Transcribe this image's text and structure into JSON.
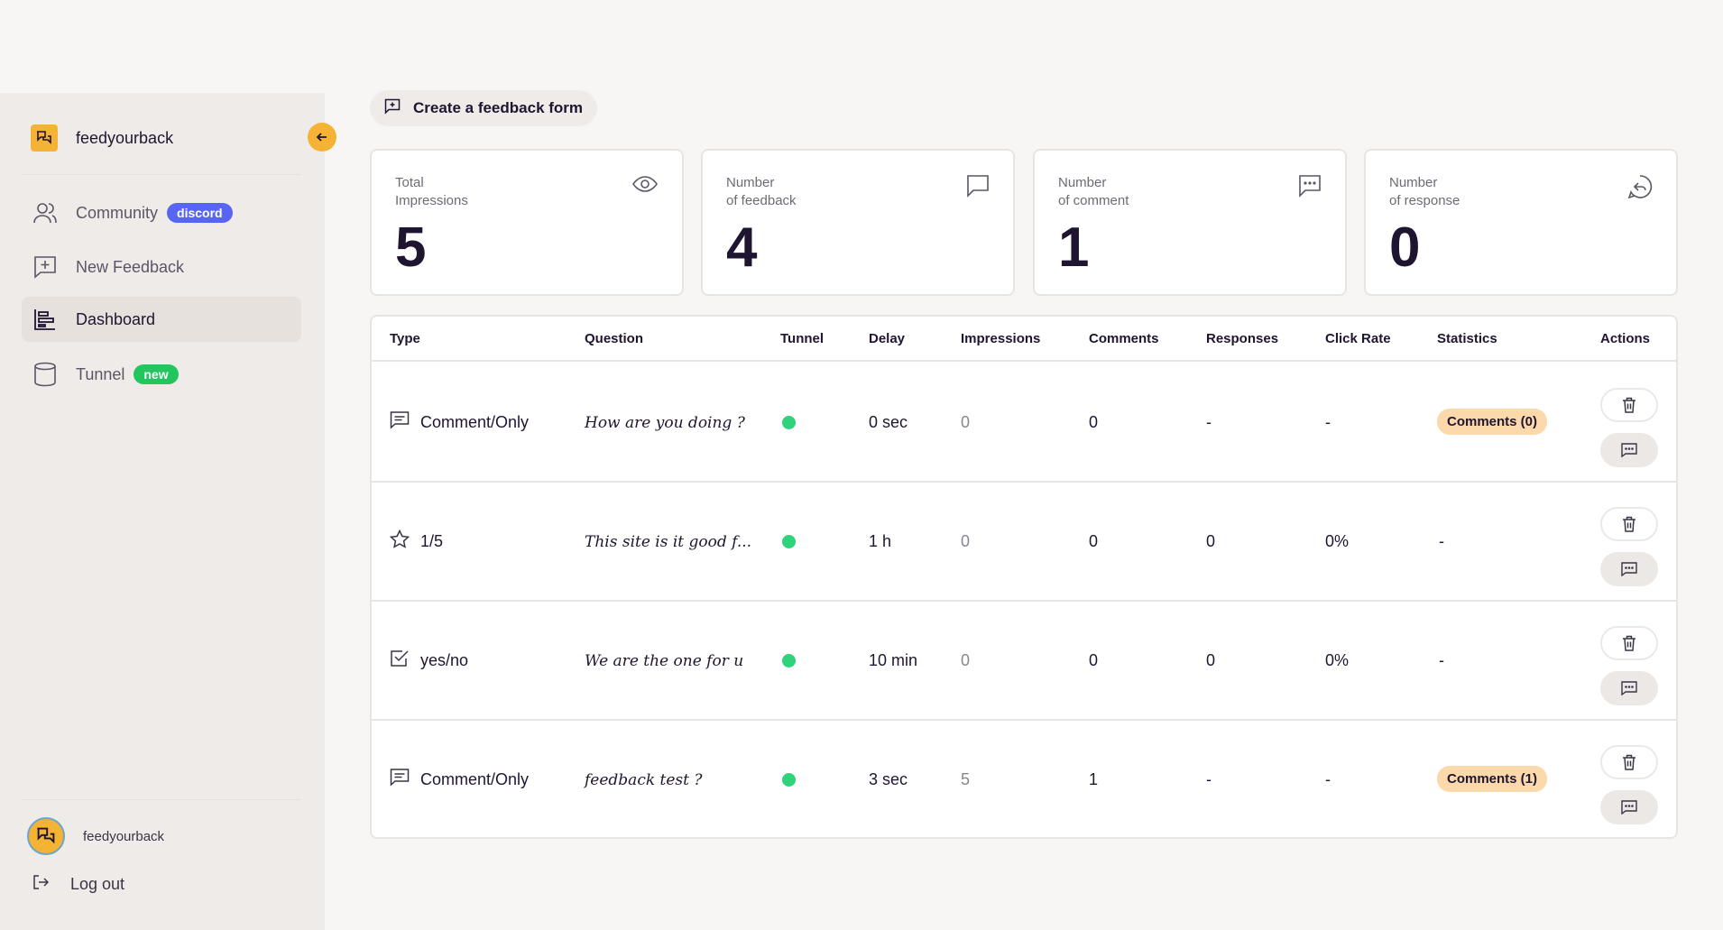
{
  "sidebar": {
    "brand_name": "feedyourback",
    "items": [
      {
        "label": "Community",
        "badge": "discord"
      },
      {
        "label": "New Feedback"
      },
      {
        "label": "Dashboard",
        "active": true
      },
      {
        "label": "Tunnel",
        "badge": "new"
      }
    ],
    "user_name": "feedyourback",
    "logout_label": "Log out"
  },
  "main": {
    "create_button_label": "Create a feedback form",
    "stats": [
      {
        "label": "Total\nImpressions",
        "value": "5",
        "icon": "eye-icon"
      },
      {
        "label": "Number\nof feedback",
        "value": "4",
        "icon": "message-square-icon"
      },
      {
        "label": "Number\nof comment",
        "value": "1",
        "icon": "message-dots-icon"
      },
      {
        "label": "Number\nof response",
        "value": "0",
        "icon": "reply-icon"
      }
    ],
    "table": {
      "headers": [
        "Type",
        "Question",
        "Tunnel",
        "Delay",
        "Impressions",
        "Comments",
        "Responses",
        "Click Rate",
        "Statistics",
        "Actions"
      ],
      "rows": [
        {
          "type_icon": "comment-icon",
          "type": "Comment/Only",
          "question": "How are you doing ?",
          "tunnel": "active",
          "delay": "0 sec",
          "impressions": "0",
          "comments": "0",
          "responses": "-",
          "click_rate": "-",
          "statistics": "Comments (0)"
        },
        {
          "type_icon": "star-icon",
          "type": "1/5",
          "question": "This site is it good f...",
          "tunnel": "active",
          "delay": "1 h",
          "impressions": "0",
          "comments": "0",
          "responses": "0",
          "click_rate": "0%",
          "statistics": "-"
        },
        {
          "type_icon": "checkbox-icon",
          "type": "yes/no",
          "question": "We are the one for u",
          "tunnel": "active",
          "delay": "10 min",
          "impressions": "0",
          "comments": "0",
          "responses": "0",
          "click_rate": "0%",
          "statistics": "-"
        },
        {
          "type_icon": "comment-icon",
          "type": "Comment/Only",
          "question": "feedback test ?",
          "tunnel": "active",
          "delay": "3 sec",
          "impressions": "5",
          "comments": "1",
          "responses": "-",
          "click_rate": "-",
          "statistics": "Comments (1)"
        }
      ]
    }
  },
  "colors": {
    "accent": "#f5b335",
    "discord_badge": "#5865f2",
    "new_badge": "#22c55e",
    "tunnel_active": "#2ed37a",
    "stat_pill": "#fbd9aa"
  }
}
